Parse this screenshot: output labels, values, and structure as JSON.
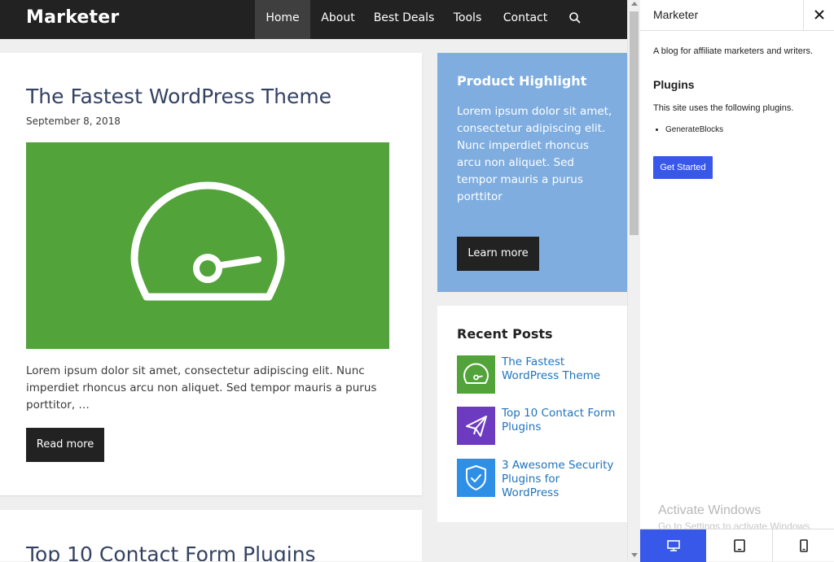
{
  "site": {
    "brand": "Marketer",
    "nav": {
      "items": [
        {
          "label": "Home"
        },
        {
          "label": "About"
        },
        {
          "label": "Best Deals"
        },
        {
          "label": "Tools"
        },
        {
          "label": "Contact"
        }
      ],
      "search_icon": "search-icon"
    }
  },
  "posts": [
    {
      "title": "The Fastest WordPress Theme",
      "date": "September 8, 2018",
      "image_icon": "speedometer-icon",
      "image_color": "#52a33a",
      "excerpt": "Lorem ipsum dolor sit amet, consectetur adipiscing elit. Nunc imperdiet rhoncus arcu non aliquet. Sed tempor mauris a purus porttitor, …",
      "read_more": "Read more"
    },
    {
      "title": "Top 10 Contact Form Plugins"
    }
  ],
  "highlight": {
    "title": "Product Highlight",
    "text": "Lorem ipsum dolor sit amet, consectetur adipiscing elit. Nunc imperdiet rhoncus arcu non aliquet. Sed tempor mauris a purus porttitor",
    "button": "Learn more",
    "bg_color": "#7faddf"
  },
  "recent_posts": {
    "title": "Recent Posts",
    "items": [
      {
        "label": "The Fastest WordPress Theme",
        "icon": "speedometer-icon",
        "color": "#52a33a"
      },
      {
        "label": "Top 10 Contact Form Plugins",
        "icon": "paper-plane-icon",
        "color": "#6d3bbf"
      },
      {
        "label": "3 Awesome Security Plugins for WordPress",
        "icon": "shield-icon",
        "color": "#2e8fe6"
      }
    ]
  },
  "panel": {
    "title": "Marketer",
    "description": "A blog for affiliate marketers and writers.",
    "plugins_heading": "Plugins",
    "plugins_intro": "This site uses the following plugins.",
    "plugins": [
      "GenerateBlocks"
    ],
    "cta": "Get Started",
    "accent": "#3858e9"
  },
  "watermark": {
    "line1": "Activate Windows",
    "line2": "Go to Settings to activate Windows."
  },
  "device_bar": {
    "active": "desktop",
    "buttons": [
      "desktop-icon",
      "tablet-icon",
      "mobile-icon"
    ]
  }
}
